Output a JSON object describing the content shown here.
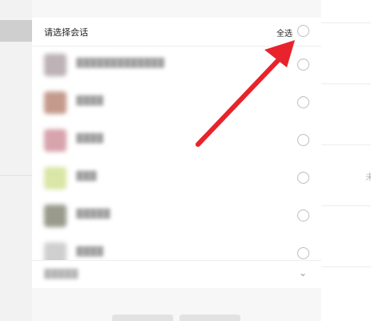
{
  "dialog": {
    "title": "请选择会话",
    "select_all_label": "全选",
    "contacts": [
      {
        "name": "▓▓▓▓▓▓▓▓▓▓▓▓▓",
        "avatar_color": "#bdb2b5"
      },
      {
        "name": "▓▓▓▓",
        "avatar_color": "#c49a8c"
      },
      {
        "name": "▓▓▓▓",
        "avatar_color": "#d7a3ad"
      },
      {
        "name": "▓▓▓",
        "avatar_color": "#d9e6a6"
      },
      {
        "name": "▓▓▓▓▓",
        "avatar_color": "#9a9a8c"
      },
      {
        "name": "▓▓▓▓",
        "avatar_color": "#cfcfcf"
      }
    ],
    "footer_label": "▓▓▓▓▓",
    "footer_chevron": "⌄",
    "confirm_label": "",
    "cancel_label": ""
  },
  "background": {
    "right_edge_char": "未"
  },
  "colors": {
    "arrow": "#e8232b",
    "panel_bg": "#f7f7f7",
    "radio_border": "#bdbdbd"
  }
}
